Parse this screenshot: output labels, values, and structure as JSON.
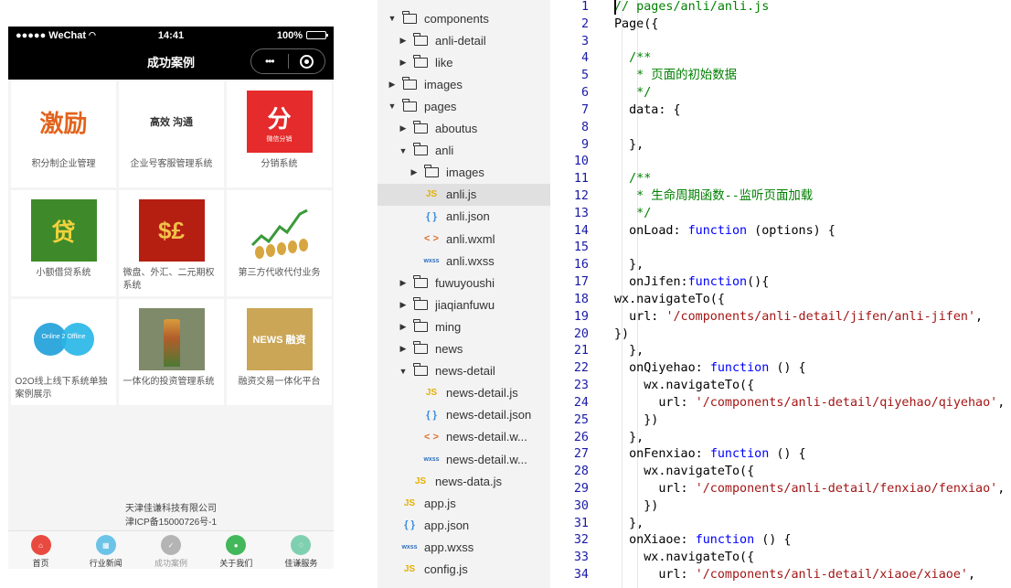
{
  "phone": {
    "status": {
      "carrier": "●●●●● WeChat",
      "time": "14:41",
      "battery_text": "100%",
      "battery_level": 1.0
    },
    "nav": {
      "title": "成功案例",
      "more_glyph": "•••"
    },
    "cases": [
      {
        "label": "积分制企业管理",
        "thumb_text": "激励",
        "thumb_bg": "#ffffff",
        "thumb_fg": "#e2631c"
      },
      {
        "label": "企业号客服管理系统",
        "thumb_text": "高效 沟通",
        "thumb_bg": "#ffffff",
        "thumb_fg": "#333333"
      },
      {
        "label": "分销系统",
        "thumb_text": "分",
        "thumb_sub": "微信分销",
        "thumb_bg": "#e52b2b",
        "thumb_fg": "#ffffff"
      },
      {
        "label": "小额借贷系统",
        "thumb_text": "贷",
        "thumb_bg": "#3e8a2a",
        "thumb_fg": "#f4d23c"
      },
      {
        "label": "微盘、外汇、二元期权系统",
        "thumb_text": "$£",
        "thumb_bg": "#b51f12",
        "thumb_fg": "#f1c14a"
      },
      {
        "label": "第三方代收代付业务",
        "thumb_text": "",
        "thumb_bg": "#ffffff",
        "thumb_fg": "#3a9a3a"
      },
      {
        "label": "O2O线上线下系统单独案例展示",
        "thumb_text": "Online 2 Offline",
        "thumb_bg": "#ffffff",
        "thumb_fg": "#1d7ec7"
      },
      {
        "label": "一体化的投资管理系统",
        "thumb_text": "",
        "thumb_bg": "#7f8a6a",
        "thumb_fg": "#d89c3c"
      },
      {
        "label": "融资交易一体化平台",
        "thumb_text": "NEWS 融资",
        "thumb_bg": "#caa656",
        "thumb_fg": "#ffffff"
      }
    ],
    "footer": {
      "line1": "天津佳谦科技有限公司",
      "line2": "津ICP备15000726号-1"
    },
    "tabs": [
      {
        "label": "首页",
        "color": "#e94a3f",
        "glyph": "⌂"
      },
      {
        "label": "行业新闻",
        "color": "#6cc3e8",
        "glyph": "▦"
      },
      {
        "label": "成功案例",
        "color": "#b4b4b4",
        "glyph": "✓"
      },
      {
        "label": "关于我们",
        "color": "#43b85a",
        "glyph": "●"
      },
      {
        "label": "佳谦服务",
        "color": "#7fd0b0",
        "glyph": "♢"
      }
    ]
  },
  "tree": [
    {
      "indent": 0,
      "arrow": "▼",
      "type": "folder",
      "name": "components"
    },
    {
      "indent": 1,
      "arrow": "▶",
      "type": "folder",
      "name": "anli-detail"
    },
    {
      "indent": 1,
      "arrow": "▶",
      "type": "folder",
      "name": "like"
    },
    {
      "indent": 0,
      "arrow": "▶",
      "type": "folder",
      "name": "images"
    },
    {
      "indent": 0,
      "arrow": "▼",
      "type": "folder",
      "name": "pages"
    },
    {
      "indent": 1,
      "arrow": "▶",
      "type": "folder",
      "name": "aboutus"
    },
    {
      "indent": 1,
      "arrow": "▼",
      "type": "folder",
      "name": "anli"
    },
    {
      "indent": 2,
      "arrow": "▶",
      "type": "folder",
      "name": "images"
    },
    {
      "indent": 2,
      "arrow": "",
      "type": "js",
      "name": "anli.js",
      "selected": true
    },
    {
      "indent": 2,
      "arrow": "",
      "type": "json",
      "name": "anli.json"
    },
    {
      "indent": 2,
      "arrow": "",
      "type": "wxml",
      "name": "anli.wxml"
    },
    {
      "indent": 2,
      "arrow": "",
      "type": "wxss",
      "name": "anli.wxss"
    },
    {
      "indent": 1,
      "arrow": "▶",
      "type": "folder",
      "name": "fuwuyoushi"
    },
    {
      "indent": 1,
      "arrow": "▶",
      "type": "folder",
      "name": "jiaqianfuwu"
    },
    {
      "indent": 1,
      "arrow": "▶",
      "type": "folder",
      "name": "ming"
    },
    {
      "indent": 1,
      "arrow": "▶",
      "type": "folder",
      "name": "news"
    },
    {
      "indent": 1,
      "arrow": "▼",
      "type": "folder",
      "name": "news-detail"
    },
    {
      "indent": 2,
      "arrow": "",
      "type": "js",
      "name": "news-detail.js"
    },
    {
      "indent": 2,
      "arrow": "",
      "type": "json",
      "name": "news-detail.json"
    },
    {
      "indent": 2,
      "arrow": "",
      "type": "wxml",
      "name": "news-detail.w..."
    },
    {
      "indent": 2,
      "arrow": "",
      "type": "wxss",
      "name": "news-detail.w..."
    },
    {
      "indent": 1,
      "arrow": "",
      "type": "js",
      "name": "news-data.js"
    },
    {
      "indent": 0,
      "arrow": "",
      "type": "js",
      "name": "app.js"
    },
    {
      "indent": 0,
      "arrow": "",
      "type": "json",
      "name": "app.json"
    },
    {
      "indent": 0,
      "arrow": "",
      "type": "wxss",
      "name": "app.wxss"
    },
    {
      "indent": 0,
      "arrow": "",
      "type": "js",
      "name": "config.js"
    }
  ],
  "file_icons": {
    "js": "JS",
    "json": "{ }",
    "wxml": "< >",
    "wxss": "wxss"
  },
  "code": [
    {
      "n": "1",
      "parts": [
        [
          "c-cm",
          "// pages/anli/anli.js"
        ]
      ]
    },
    {
      "n": "2",
      "parts": [
        [
          "",
          "Page({"
        ]
      ]
    },
    {
      "n": "3",
      "parts": []
    },
    {
      "n": "4",
      "parts": [
        [
          "c-cm",
          "  /**"
        ]
      ]
    },
    {
      "n": "5",
      "parts": [
        [
          "c-cm",
          "   * 页面的初始数据"
        ]
      ]
    },
    {
      "n": "6",
      "parts": [
        [
          "c-cm",
          "   */"
        ]
      ]
    },
    {
      "n": "7",
      "parts": [
        [
          "",
          "  data: {"
        ]
      ]
    },
    {
      "n": "8",
      "parts": []
    },
    {
      "n": "9",
      "parts": [
        [
          "",
          "  },"
        ]
      ]
    },
    {
      "n": "10",
      "parts": []
    },
    {
      "n": "11",
      "parts": [
        [
          "c-cm",
          "  /**"
        ]
      ]
    },
    {
      "n": "12",
      "parts": [
        [
          "c-cm",
          "   * 生命周期函数--监听页面加载"
        ]
      ]
    },
    {
      "n": "13",
      "parts": [
        [
          "c-cm",
          "   */"
        ]
      ]
    },
    {
      "n": "14",
      "parts": [
        [
          "",
          "  onLoad: "
        ],
        [
          "c-kw",
          "function"
        ],
        [
          "",
          " (options) {"
        ]
      ]
    },
    {
      "n": "15",
      "parts": []
    },
    {
      "n": "16",
      "parts": [
        [
          "",
          "  },"
        ]
      ]
    },
    {
      "n": "17",
      "parts": [
        [
          "",
          "  onJifen:"
        ],
        [
          "c-kw",
          "function"
        ],
        [
          "",
          "(){"
        ]
      ]
    },
    {
      "n": "18",
      "parts": [
        [
          "",
          "wx.navigateTo({"
        ]
      ]
    },
    {
      "n": "19",
      "parts": [
        [
          "",
          "  url: "
        ],
        [
          "c-str",
          "'/components/anli-detail/jifen/anli-jifen'"
        ],
        [
          "",
          ","
        ]
      ]
    },
    {
      "n": "20",
      "parts": [
        [
          "",
          "})"
        ]
      ]
    },
    {
      "n": "21",
      "parts": [
        [
          "",
          "  },"
        ]
      ]
    },
    {
      "n": "22",
      "parts": [
        [
          "",
          "  onQiyehao: "
        ],
        [
          "c-kw",
          "function"
        ],
        [
          "",
          " () {"
        ]
      ]
    },
    {
      "n": "23",
      "parts": [
        [
          "",
          "    wx.navigateTo({"
        ]
      ]
    },
    {
      "n": "24",
      "parts": [
        [
          "",
          "      url: "
        ],
        [
          "c-str",
          "'/components/anli-detail/qiyehao/qiyehao'"
        ],
        [
          "",
          ","
        ]
      ]
    },
    {
      "n": "25",
      "parts": [
        [
          "",
          "    })"
        ]
      ]
    },
    {
      "n": "26",
      "parts": [
        [
          "",
          "  },"
        ]
      ]
    },
    {
      "n": "27",
      "parts": [
        [
          "",
          "  onFenxiao: "
        ],
        [
          "c-kw",
          "function"
        ],
        [
          "",
          " () {"
        ]
      ]
    },
    {
      "n": "28",
      "parts": [
        [
          "",
          "    wx.navigateTo({"
        ]
      ]
    },
    {
      "n": "29",
      "parts": [
        [
          "",
          "      url: "
        ],
        [
          "c-str",
          "'/components/anli-detail/fenxiao/fenxiao'"
        ],
        [
          "",
          ","
        ]
      ]
    },
    {
      "n": "30",
      "parts": [
        [
          "",
          "    })"
        ]
      ]
    },
    {
      "n": "31",
      "parts": [
        [
          "",
          "  },"
        ]
      ]
    },
    {
      "n": "32",
      "parts": [
        [
          "",
          "  onXiaoe: "
        ],
        [
          "c-kw",
          "function"
        ],
        [
          "",
          " () {"
        ]
      ]
    },
    {
      "n": "33",
      "parts": [
        [
          "",
          "    wx.navigateTo({"
        ]
      ]
    },
    {
      "n": "34",
      "parts": [
        [
          "",
          "      url: "
        ],
        [
          "c-str",
          "'/components/anli-detail/xiaoe/xiaoe'"
        ],
        [
          "",
          ","
        ]
      ]
    }
  ]
}
